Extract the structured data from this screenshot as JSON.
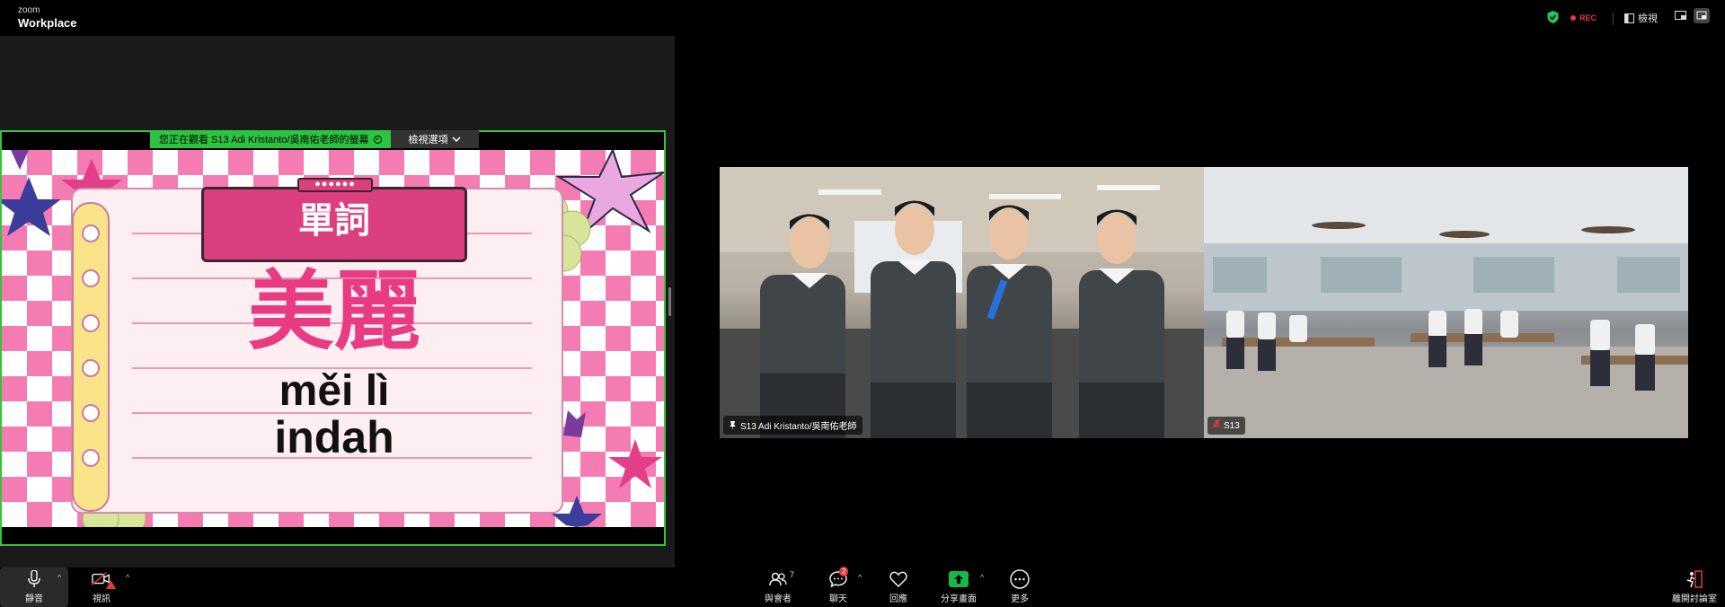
{
  "app": {
    "brand_top": "zoom",
    "brand_bottom": "Workplace"
  },
  "topbar": {
    "rec_label": "REC",
    "view_label": "檢視"
  },
  "share": {
    "notice": "您正在觀看 S13 Adi Kristanto/吳南佑老師的螢幕",
    "view_options": "檢視選項"
  },
  "slide": {
    "tab_text": "●●●●●●",
    "title": "單詞",
    "word_chinese": "美麗",
    "word_pinyin": "měi lì",
    "word_indonesian": "indah"
  },
  "videos": [
    {
      "name": "S13 Adi Kristanto/吳南佑老師"
    },
    {
      "name": "S13"
    }
  ],
  "toolbar": {
    "mute": "靜音",
    "video": "視訊",
    "participants": "與會者",
    "participants_count": "7",
    "chat": "聊天",
    "chat_badge": "2",
    "reactions": "回應",
    "share": "分享畫面",
    "more": "更多",
    "leave": "離開討論室"
  },
  "colors": {
    "share_border": "#35c33d",
    "slide_accent": "#dc3f7f",
    "rec": "#e0393e"
  }
}
